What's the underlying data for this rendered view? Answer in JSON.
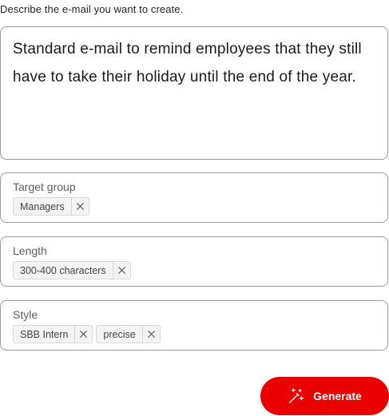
{
  "prompt": {
    "label": "Describe the e-mail you want to create.",
    "value": "Standard e-mail to remind employees that they still have to take their holiday until the end of the year."
  },
  "target_group": {
    "label": "Target group",
    "chips": [
      "Managers"
    ]
  },
  "length": {
    "label": "Length",
    "chips": [
      "300-400 characters"
    ]
  },
  "style": {
    "label": "Style",
    "chips": [
      "SBB Intern",
      "precise"
    ]
  },
  "generate": {
    "label": "Generate",
    "icon": "magic-wand-icon"
  },
  "colors": {
    "accent": "#eb0000",
    "border": "#9a9a9a",
    "chip_bg": "#f4f4f4"
  }
}
